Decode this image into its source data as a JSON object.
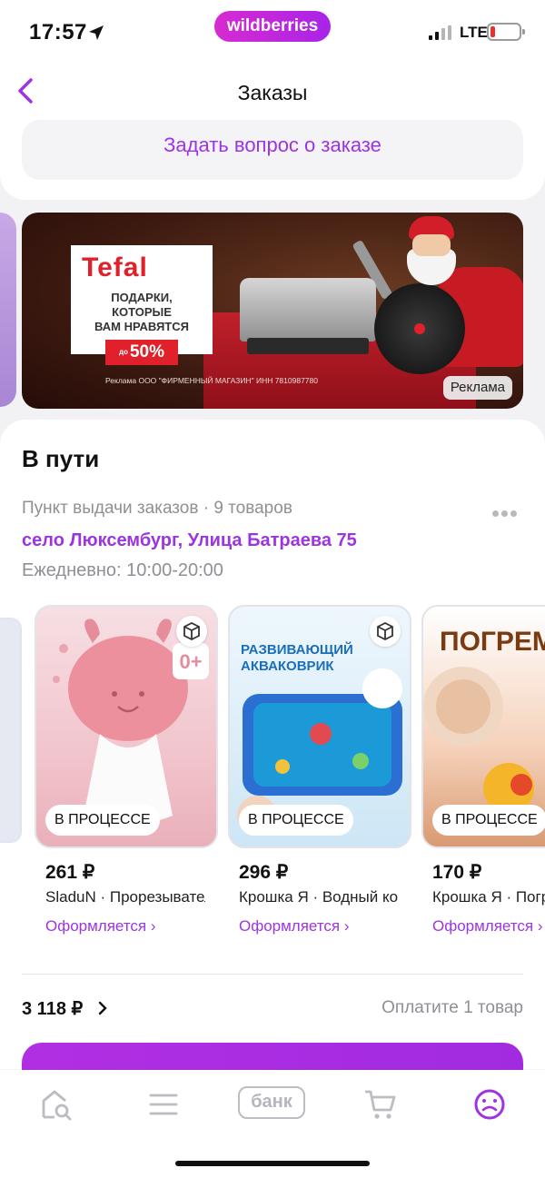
{
  "status_bar": {
    "time": "17:57",
    "app_badge": "wildberries",
    "network": "LTE"
  },
  "nav": {
    "title": "Заказы"
  },
  "ask_button": "Задать вопрос о заказе",
  "banner": {
    "brand": "Tefal",
    "line1": "ПОДАРКИ,",
    "line2": "КОТОРЫЕ",
    "line3": "ВАМ НРАВЯТСЯ",
    "discount_prefix": "до",
    "discount": "50%",
    "legal": "Реклама ООО \"ФИРМЕННЫЙ МАГАЗИН\" ИНН 7810987780",
    "ad_label": "Реклама"
  },
  "order": {
    "section_title": "В пути",
    "pickup": "Пункт выдачи заказов · 9 товаров",
    "address": "село Люксембург, Улица Батраева 75",
    "hours": "Ежедневно: 10:00-20:00",
    "items": [
      {
        "status": "В ПРОЦЕССЕ",
        "price": "261 ₽",
        "desc": "SladuN · Прорезыватель",
        "link": "Оформляется ›"
      },
      {
        "status": "В ПРОЦЕССЕ",
        "price": "296 ₽",
        "desc": "Крошка Я · Водный коврик",
        "link": "Оформляется ›"
      },
      {
        "status": "В ПРОЦЕССЕ",
        "price": "170 ₽",
        "desc": "Крошка Я · Погремушка",
        "link": "Оформляется ›"
      }
    ],
    "total": "3 118 ₽",
    "pay_hint": "Оплатите 1 товар"
  },
  "tabbar": {
    "bank_label": "банк"
  },
  "colors": {
    "accent": "#9d34e1",
    "brand_pink": "#d72bd0",
    "muted": "#8f8f95"
  }
}
